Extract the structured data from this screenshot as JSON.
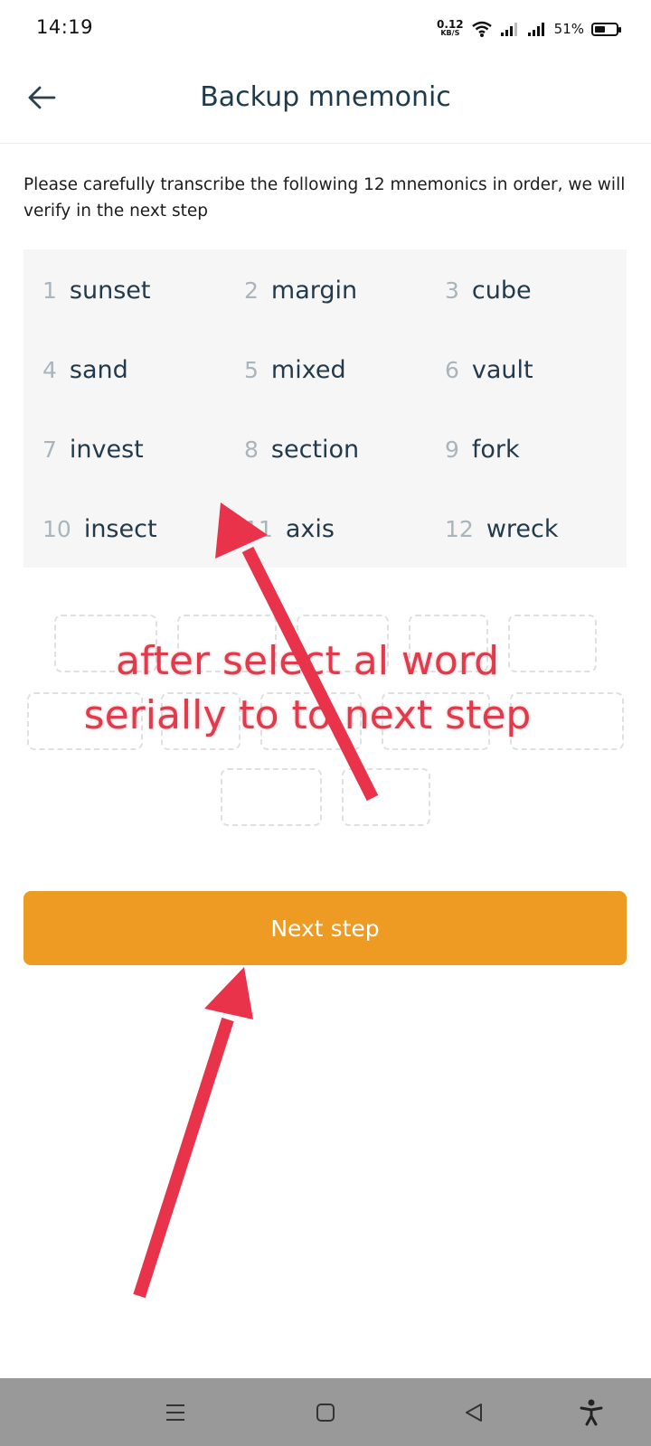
{
  "status_bar": {
    "time": "14:19",
    "net_speed_value": "0.12",
    "net_speed_unit": "KB/S",
    "battery_percent": "51%",
    "battery_level": 0.51
  },
  "header": {
    "title": "Backup mnemonic"
  },
  "instruction": "Please carefully transcribe the following 12 mnemonics in order, we will verify in the next step",
  "mnemonics": [
    {
      "num": "1",
      "word": "sunset"
    },
    {
      "num": "2",
      "word": "margin"
    },
    {
      "num": "3",
      "word": "cube"
    },
    {
      "num": "4",
      "word": "sand"
    },
    {
      "num": "5",
      "word": "mixed"
    },
    {
      "num": "6",
      "word": "vault"
    },
    {
      "num": "7",
      "word": "invest"
    },
    {
      "num": "8",
      "word": "section"
    },
    {
      "num": "9",
      "word": "fork"
    },
    {
      "num": "10",
      "word": "insect"
    },
    {
      "num": "11",
      "word": "axis"
    },
    {
      "num": "12",
      "word": "wreck"
    }
  ],
  "annotation": {
    "line1": "after select al word",
    "line2": "serially to to next step",
    "color": "#e8334a"
  },
  "next_button": {
    "label": "Next step",
    "color": "#ee9b24"
  },
  "nav_bar": {
    "items": [
      "menu-icon",
      "home-icon",
      "back-triangle-icon",
      "accessibility-icon"
    ]
  }
}
